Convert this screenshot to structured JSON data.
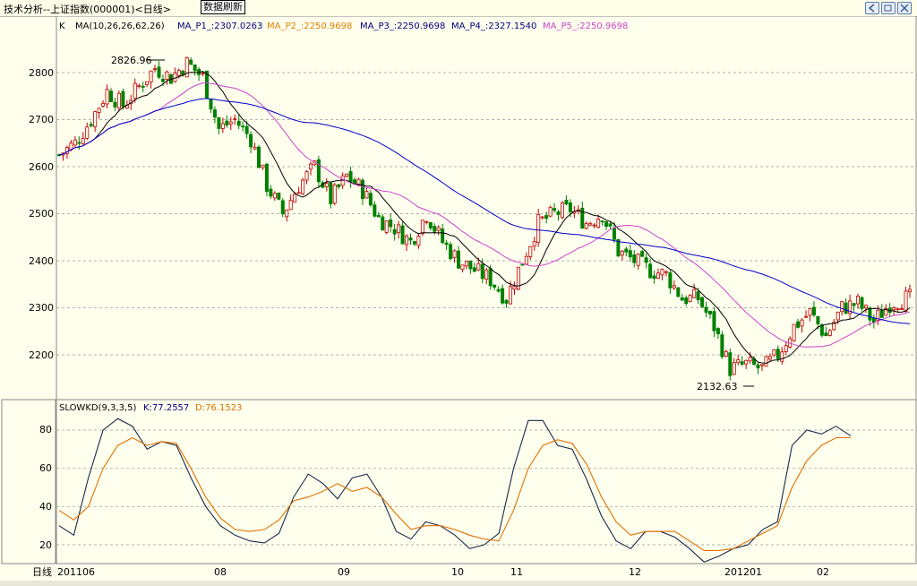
{
  "window": {
    "title": "技术分析--上证指数(000001)<日线>",
    "refresh_label": "数据刷新"
  },
  "main_panel": {
    "header": {
      "k_label": "K",
      "ma_label": "MA(10,26,26,62,26)",
      "ma_p1": "MA_P1_:2307.0263",
      "ma_p2": "MA_P2_:2250.9698",
      "ma_p3": "MA_P3_:2250.9698",
      "ma_p4": "MA_P4_:2327.1540",
      "ma_p5": "MA_P5_:2250.9698"
    },
    "y_ticks": [
      "2800",
      "2700",
      "2600",
      "2500",
      "2400",
      "2300",
      "2200"
    ],
    "high_annotation": "2826.96",
    "low_annotation": "2132.63"
  },
  "kd_panel": {
    "header": {
      "name": "SLOWKD(9,3,3,5)",
      "k_value": "K:77.2557",
      "d_value": "D:76.1523"
    },
    "y_ticks": [
      "80",
      "60",
      "40",
      "20"
    ]
  },
  "x_axis": {
    "corner_label": "日线",
    "labels": [
      "201106",
      "08",
      "09",
      "10",
      "11",
      "12",
      "201201",
      "02"
    ]
  },
  "colors": {
    "background": "#ffffee",
    "up_candle": "#c00000",
    "down_candle": "#008000",
    "ma_short": "#000000",
    "ma_mid": "#cc44cc",
    "ma_long": "#0000cc",
    "kd_k": "#1a2a4a",
    "kd_d": "#e07000",
    "ma_p1_color": "#000080",
    "ma_p2_color": "#e08000",
    "ma_p3_color": "#000080",
    "ma_p4_color": "#000080",
    "ma_p5_color": "#cc44cc"
  },
  "chart_data": [
    {
      "type": "candlestick",
      "ylim": [
        2130,
        2900
      ],
      "y_ticks": [
        2200,
        2300,
        2400,
        2500,
        2600,
        2700,
        2800
      ],
      "close_path": [
        [
          0,
          2625
        ],
        [
          4,
          2650
        ],
        [
          8,
          2700
        ],
        [
          12,
          2760
        ],
        [
          16,
          2730
        ],
        [
          20,
          2770
        ],
        [
          24,
          2810
        ],
        [
          28,
          2790
        ],
        [
          32,
          2820
        ],
        [
          36,
          2790
        ],
        [
          40,
          2680
        ],
        [
          44,
          2700
        ],
        [
          48,
          2660
        ],
        [
          52,
          2560
        ],
        [
          56,
          2500
        ],
        [
          60,
          2560
        ],
        [
          64,
          2600
        ],
        [
          68,
          2530
        ],
        [
          72,
          2580
        ],
        [
          76,
          2550
        ],
        [
          80,
          2490
        ],
        [
          84,
          2470
        ],
        [
          88,
          2440
        ],
        [
          92,
          2500
        ],
        [
          96,
          2440
        ],
        [
          100,
          2400
        ],
        [
          104,
          2380
        ],
        [
          108,
          2360
        ],
        [
          112,
          2320
        ],
        [
          116,
          2400
        ],
        [
          120,
          2480
        ],
        [
          124,
          2500
        ],
        [
          128,
          2510
        ],
        [
          132,
          2480
        ],
        [
          136,
          2500
        ],
        [
          140,
          2420
        ],
        [
          144,
          2400
        ],
        [
          148,
          2380
        ],
        [
          152,
          2370
        ],
        [
          156,
          2320
        ],
        [
          160,
          2320
        ],
        [
          164,
          2260
        ],
        [
          168,
          2170
        ],
        [
          172,
          2180
        ],
        [
          176,
          2170
        ],
        [
          180,
          2200
        ],
        [
          184,
          2260
        ],
        [
          188,
          2290
        ],
        [
          192,
          2240
        ],
        [
          196,
          2300
        ],
        [
          200,
          2310
        ],
        [
          204,
          2270
        ],
        [
          208,
          2310
        ],
        [
          212,
          2320
        ]
      ],
      "high": 2826.96,
      "low": 2132.63
    },
    {
      "type": "line",
      "title": "SLOWKD(9,3,3,5)",
      "ylim": [
        10,
        90
      ],
      "y_ticks": [
        20,
        40,
        60,
        80
      ],
      "series": [
        {
          "name": "K",
          "values": [
            30,
            25,
            55,
            80,
            86,
            82,
            70,
            74,
            72,
            55,
            40,
            30,
            25,
            22,
            21,
            26,
            45,
            57,
            52,
            44,
            55,
            57,
            45,
            27,
            23,
            32,
            30,
            25,
            18,
            20,
            26,
            60,
            85,
            85,
            72,
            70,
            54,
            35,
            22,
            18,
            27,
            27,
            24,
            18,
            11,
            14,
            18,
            20,
            28,
            32,
            72,
            80,
            78,
            82,
            77
          ]
        },
        {
          "name": "D",
          "values": [
            38,
            33,
            40,
            60,
            72,
            76,
            72,
            74,
            73,
            60,
            45,
            34,
            28,
            27,
            28,
            33,
            43,
            45,
            48,
            52,
            48,
            50,
            45,
            36,
            28,
            30,
            30,
            28,
            25,
            23,
            22,
            38,
            60,
            72,
            75,
            73,
            62,
            45,
            32,
            25,
            27,
            27,
            27,
            22,
            17,
            17,
            18,
            22,
            26,
            30,
            50,
            64,
            72,
            76,
            76
          ]
        }
      ],
      "k_last": 77.2557,
      "d_last": 76.1523
    }
  ]
}
